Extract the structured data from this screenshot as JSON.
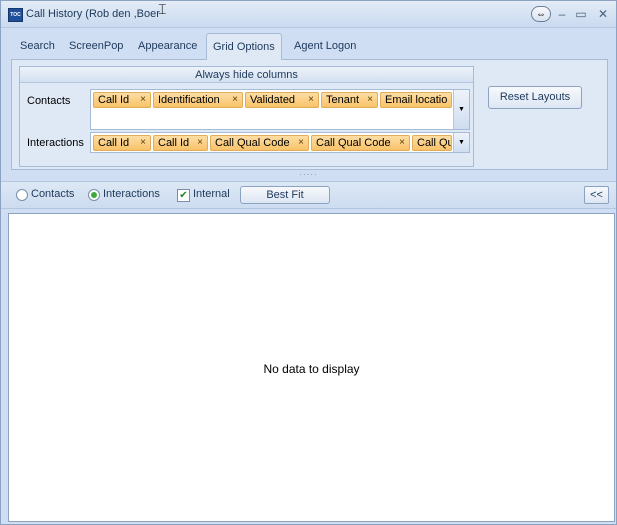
{
  "window": {
    "title": "Call History (Rob den ,Boer",
    "icon": "toc-app-icon",
    "controls": {
      "resize_glyph": "⇔",
      "minimize_glyph": "‒",
      "maximize_glyph": "▭",
      "close_glyph": "✕"
    }
  },
  "tabs": [
    {
      "label": "Search"
    },
    {
      "label": "ScreenPop"
    },
    {
      "label": "Appearance"
    },
    {
      "label": "Grid Options",
      "active": true
    },
    {
      "label": "Agent Logon"
    }
  ],
  "grid_options": {
    "group_title": "Always hide columns",
    "contacts": {
      "label": "Contacts",
      "tokens": [
        "Call Id",
        "Identification",
        "Validated",
        "Tenant",
        "Email locatio"
      ]
    },
    "interactions": {
      "label": "Interactions",
      "tokens": [
        "Call Id",
        "Call Id",
        "Call Qual Code",
        "Call Qual Code",
        "Call Qu"
      ]
    },
    "token_remove_glyph": "×",
    "reset_button": "Reset Layouts"
  },
  "options_bar": {
    "radio_contacts": "Contacts",
    "radio_interactions": "Interactions",
    "selected": "Interactions",
    "internal_label": "Internal",
    "internal_checked": true,
    "best_fit_button": "Best Fit",
    "collapse_button": "<<"
  },
  "grid": {
    "empty_message": "No data to display"
  },
  "colors": {
    "token_fill": "#f9c26a",
    "panel": "#dfe9f5",
    "frame": "#cfdef3"
  }
}
